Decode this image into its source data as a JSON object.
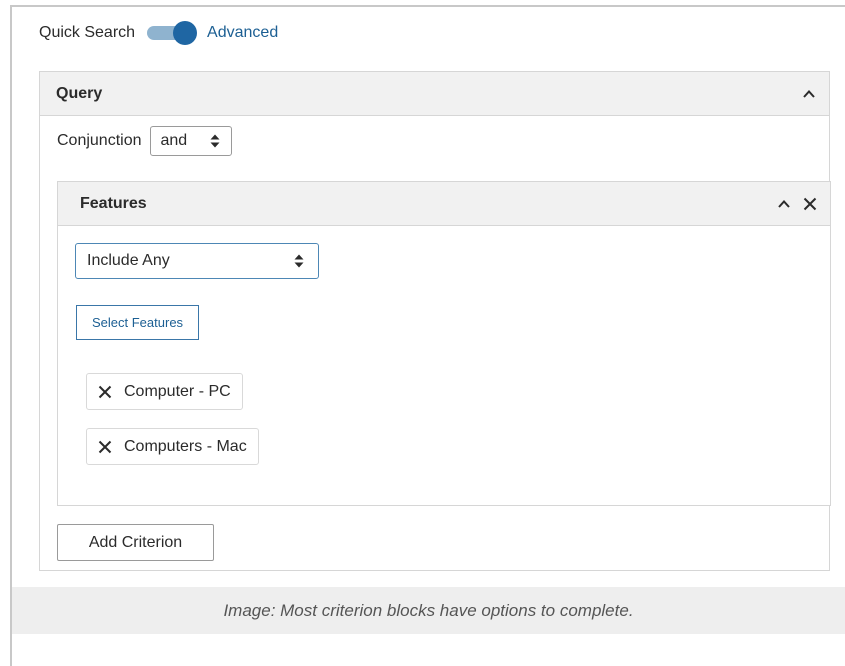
{
  "toggle": {
    "left_label": "Quick Search",
    "right_label": "Advanced"
  },
  "query": {
    "title": "Query",
    "conjunction_label": "Conjunction",
    "conjunction_value": "and",
    "features": {
      "title": "Features",
      "include_value": "Include Any",
      "select_button": "Select Features",
      "chips": [
        "Computer - PC",
        "Computers - Mac"
      ]
    },
    "add_criterion_button": "Add Criterion"
  },
  "caption": "Image: Most criterion blocks have options to complete.",
  "colors": {
    "accent": "#1f66a3",
    "link": "#1c5f93",
    "header_bg": "#f1f1f1",
    "caption_bg": "#eeeeee"
  },
  "icons": [
    "chevron-up-icon",
    "close-icon",
    "updown-icon"
  ]
}
